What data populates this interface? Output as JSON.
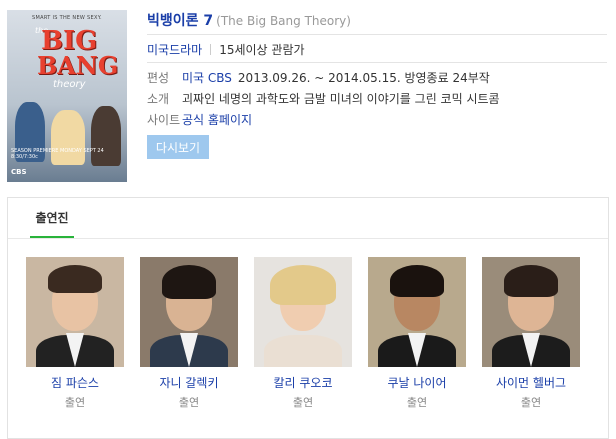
{
  "poster": {
    "tagline": "SMART IS THE NEW SEXY.",
    "logo_the": "the",
    "logo_big": "BIG",
    "logo_bang": "BANG",
    "logo_theory": "theory",
    "premiere": "SEASON PREMIERE MONDAY SEPT 24 8:30/7:30c",
    "network": "CBS"
  },
  "show": {
    "title": "빅뱅이론 7",
    "original_title": "(The Big Bang Theory)",
    "genre": "미국드라마",
    "rating": "15세이상 관람가"
  },
  "info": {
    "broadcast_label": "편성",
    "broadcast_link": "미국 CBS",
    "broadcast_text": "2013.09.26. ~ 2014.05.15. 방영종료 24부작",
    "summary_label": "소개",
    "summary_text": "괴짜인 네명의 과학도와 금발 미녀의 이야기를 그린 코믹 시트콤",
    "site_label": "사이트",
    "site_link": "공식 홈페이지"
  },
  "watch_button": "다시보기",
  "cast": {
    "tab_label": "출연진",
    "members": [
      {
        "name": "짐 파슨스",
        "role": "출연"
      },
      {
        "name": "자니 갈렉키",
        "role": "출연"
      },
      {
        "name": "칼리 쿠오코",
        "role": "출연"
      },
      {
        "name": "쿠날 나이어",
        "role": "출연"
      },
      {
        "name": "사이먼 헬버그",
        "role": "출연"
      }
    ]
  }
}
